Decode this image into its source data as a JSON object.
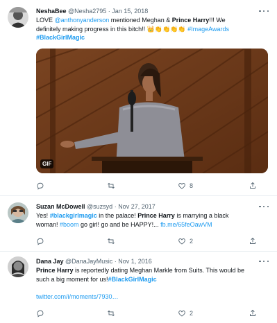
{
  "tweets": [
    {
      "name": "NeshaBee",
      "handle": "@Nesha2795",
      "sep": " · ",
      "date": "Jan 15, 2018",
      "line1_a": "LOVE ",
      "line1_link": "@anthonyanderson",
      "line1_b": " mentioned Meghan & ",
      "line1_bold": "Prince Harry",
      "line1_c": "!!! We",
      "line2_a": "definitely making progress in this bitch!! ",
      "line2_emoji": "👑👏👏👏👏",
      "line2_link": " #ImageAwards",
      "line3_link": "#BlackGirlMagic",
      "media_badge": "GIF",
      "reply_count": "",
      "retweet_count": "",
      "like_count": "8"
    },
    {
      "name": "Suzan McDowell",
      "handle": "@suzsyd",
      "sep": " · ",
      "date": "Nov 27, 2017",
      "line1_a": "Yes! ",
      "line1_link": "#blackgirlmagic",
      "line1_b": " in the palace! ",
      "line1_bold": "Prince Harry",
      "line1_c": " is marrying a black",
      "line2_a": "woman! ",
      "line2_link": "#boom",
      "line2_b": " go girl! go and be HAPPY!... ",
      "line2_link2": "fb.me/65feOawVM",
      "reply_count": "",
      "retweet_count": "",
      "like_count": "2"
    },
    {
      "name": "Dana Jay",
      "handle": "@DanaJayMusic",
      "sep": " · ",
      "date": "Nov 1, 2016",
      "line1_bold": "Prince Harry",
      "line1_a": " is reportedly dating Meghan Markle from Suits. This would be",
      "line2_a": "such a big moment for us!",
      "line2_link": "#BlackGirlMagic",
      "line3_link": "twitter.com/i/moments/7930…",
      "reply_count": "",
      "retweet_count": "",
      "like_count": "2"
    }
  ],
  "icons": {
    "reply": "reply-icon",
    "retweet": "retweet-icon",
    "like": "heart-icon",
    "share": "share-icon",
    "more": "more-icon"
  },
  "colors": {
    "link": "#1d9bf0",
    "text": "#0f1419",
    "meta": "#536471",
    "divider": "#e6ecf0"
  }
}
